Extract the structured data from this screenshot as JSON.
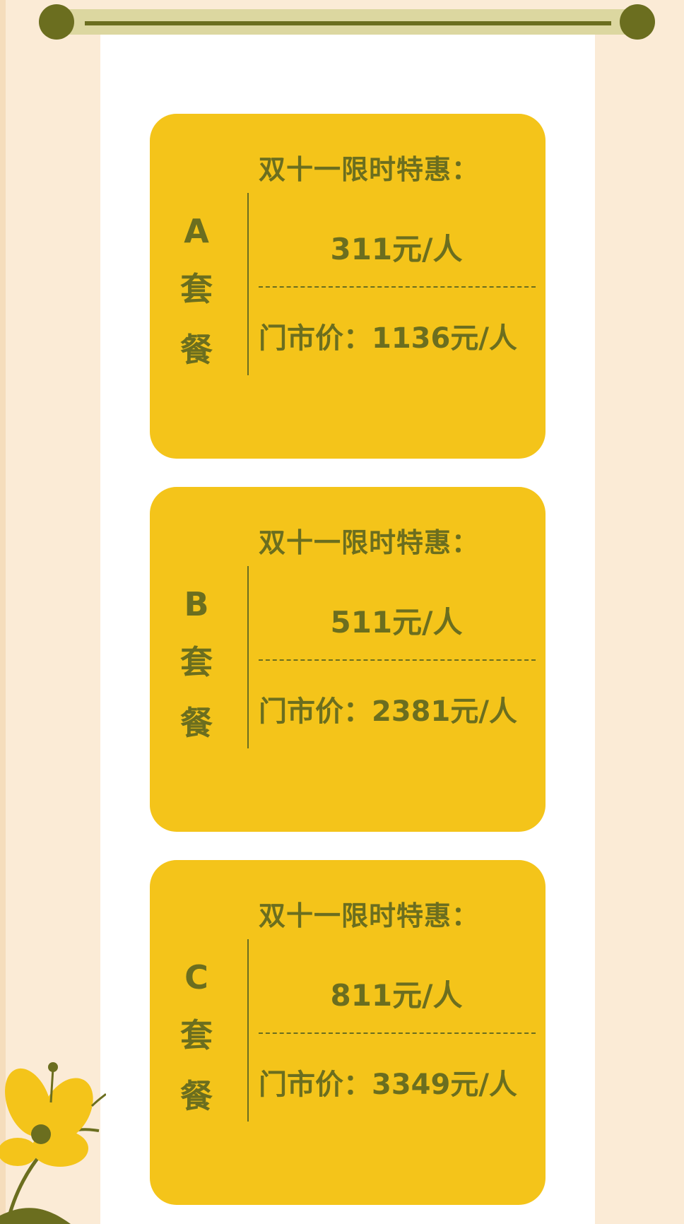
{
  "colors": {
    "background": "#FBEBD6",
    "paper": "#FFFFFF",
    "card": "#F4C41A",
    "text": "#6B6E1F",
    "rod": "#DCD7A0",
    "knob": "#6B6E1F"
  },
  "cards": [
    {
      "letter": "A",
      "name": "套\n餐",
      "promo_label": "双十一限时特惠：",
      "promo_price": "311元/人",
      "market_price": "门市价：1136元/人"
    },
    {
      "letter": "B",
      "name": "套\n餐",
      "promo_label": "双十一限时特惠：",
      "promo_price": "511元/人",
      "market_price": "门市价：2381元/人"
    },
    {
      "letter": "C",
      "name": "套\n餐",
      "promo_label": "双十一限时特惠：",
      "promo_price": "811元/人",
      "market_price": "门市价：3349元/人"
    }
  ],
  "decorations": {
    "scroll": "scroll-rod",
    "flower_icon": "flower-icon"
  }
}
